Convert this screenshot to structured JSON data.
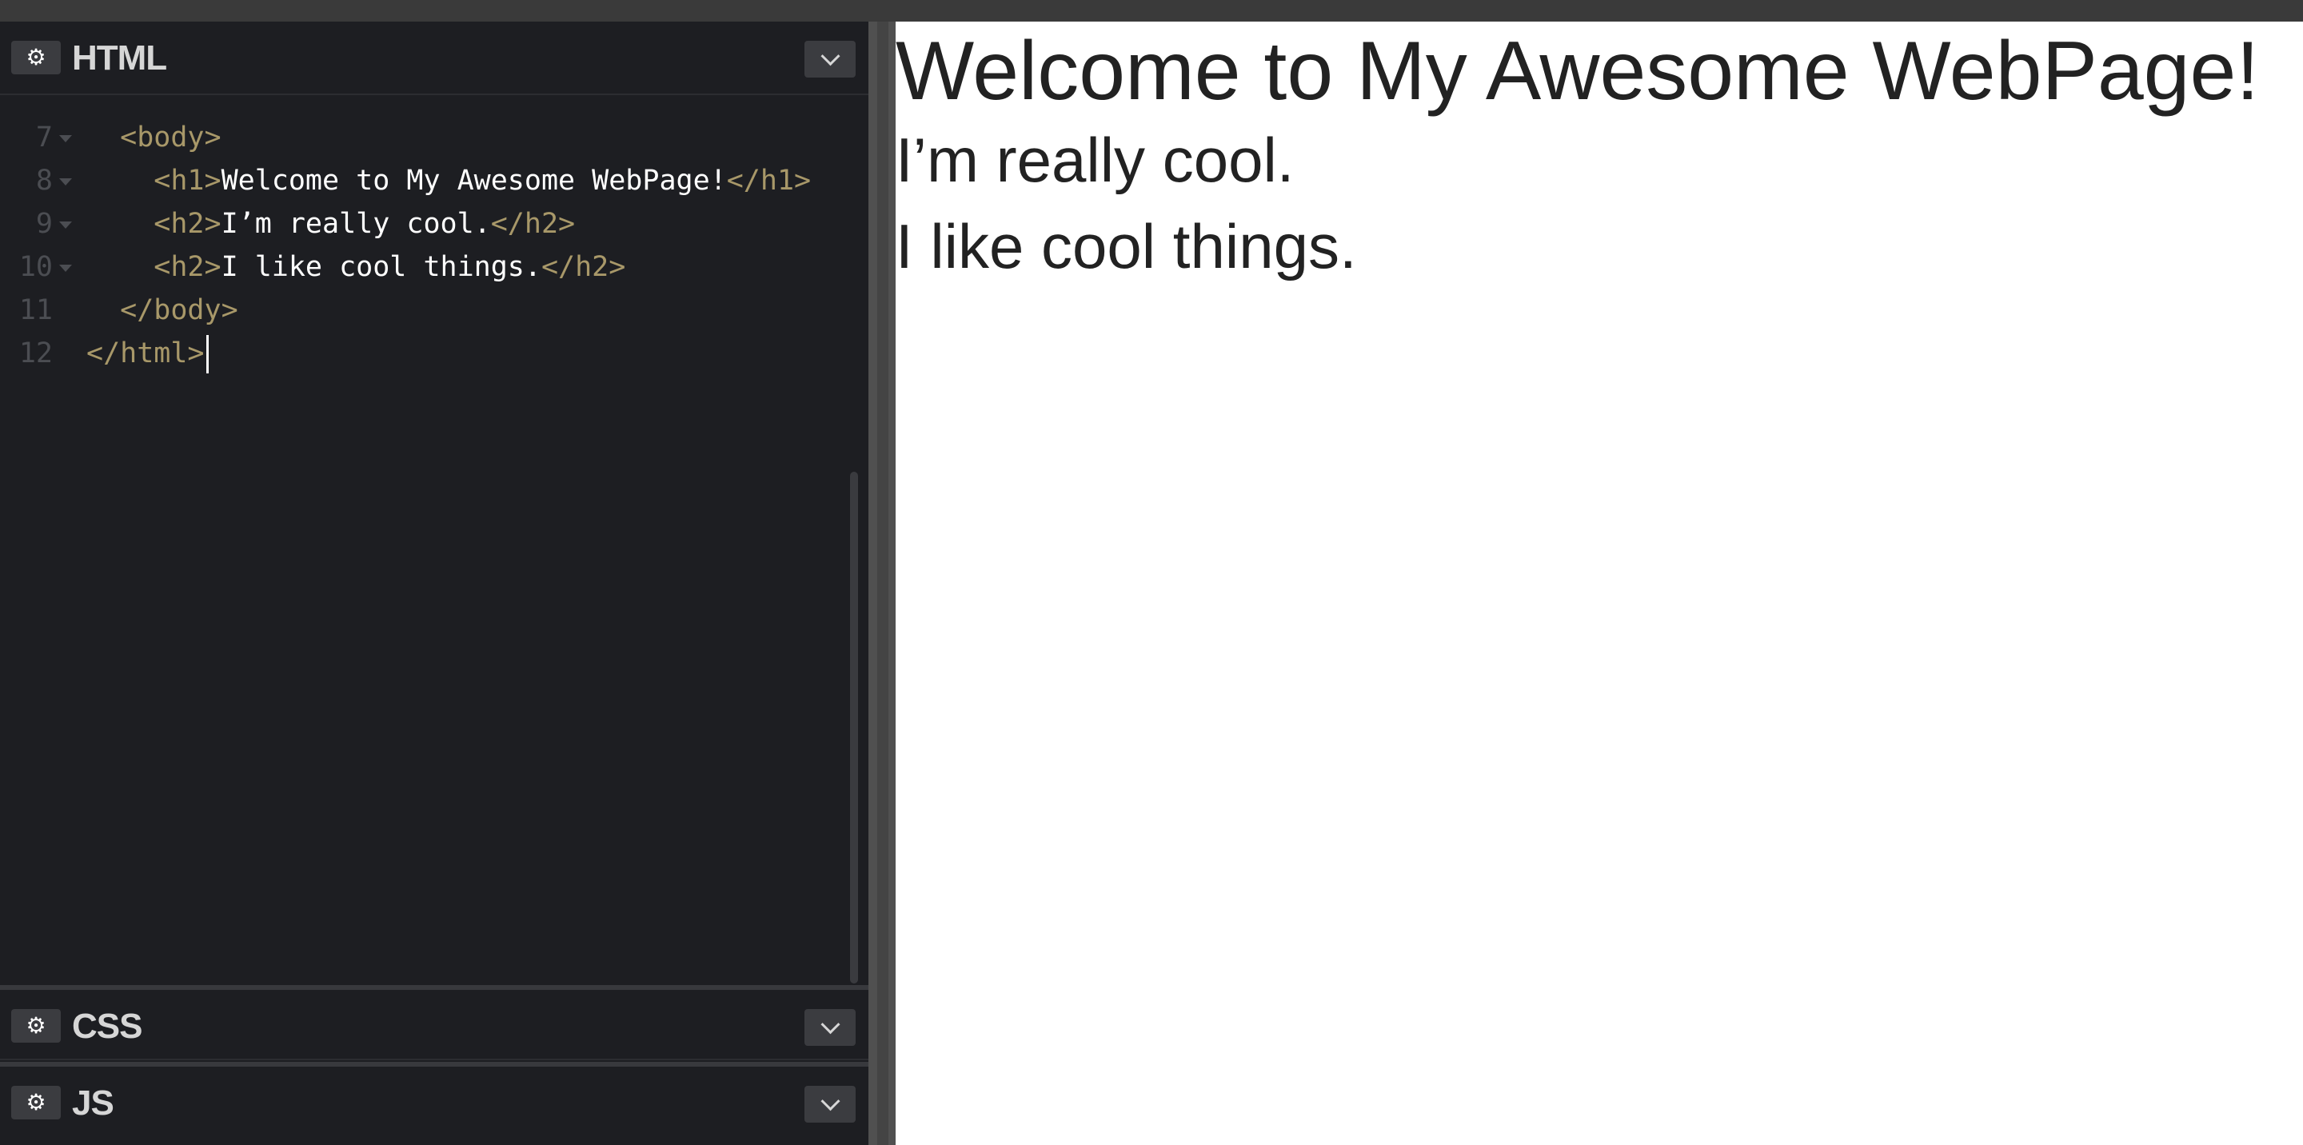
{
  "editors": {
    "html": {
      "title": "HTML"
    },
    "css": {
      "title": "CSS"
    },
    "js": {
      "title": "JS"
    }
  },
  "code": {
    "lines": [
      {
        "number": "7",
        "foldable": true,
        "parts": [
          {
            "t": "tag",
            "v": "  <body>"
          }
        ]
      },
      {
        "number": "8",
        "foldable": true,
        "parts": [
          {
            "t": "tag",
            "v": "    <h1>"
          },
          {
            "t": "txt",
            "v": "Welcome to My Awesome WebPage!"
          },
          {
            "t": "tag",
            "v": "</h1>"
          }
        ]
      },
      {
        "number": "9",
        "foldable": true,
        "parts": [
          {
            "t": "tag",
            "v": "    <h2>"
          },
          {
            "t": "txt",
            "v": "I’m really cool."
          },
          {
            "t": "tag",
            "v": "</h2>"
          }
        ]
      },
      {
        "number": "10",
        "foldable": true,
        "parts": [
          {
            "t": "tag",
            "v": "    <h2>"
          },
          {
            "t": "txt",
            "v": "I like cool things."
          },
          {
            "t": "tag",
            "v": "</h2>"
          }
        ]
      },
      {
        "number": "11",
        "foldable": false,
        "parts": [
          {
            "t": "tag",
            "v": "  </body>"
          }
        ]
      },
      {
        "number": "12",
        "foldable": false,
        "parts": [
          {
            "t": "tag",
            "v": "</html>"
          }
        ],
        "cursor": true
      }
    ]
  },
  "preview": {
    "h1": "Welcome to My Awesome WebPage!",
    "h2_first": "I’m really cool.",
    "h2_second": "I like cool things."
  },
  "icons": {
    "gear": "gear-icon",
    "chevron": "chevron-down-icon"
  },
  "colors": {
    "editor_bg": "#1d1e22",
    "tag": "#a89869",
    "text": "#ffffff",
    "line_number": "#4b4d52",
    "preview_text": "#222222"
  }
}
